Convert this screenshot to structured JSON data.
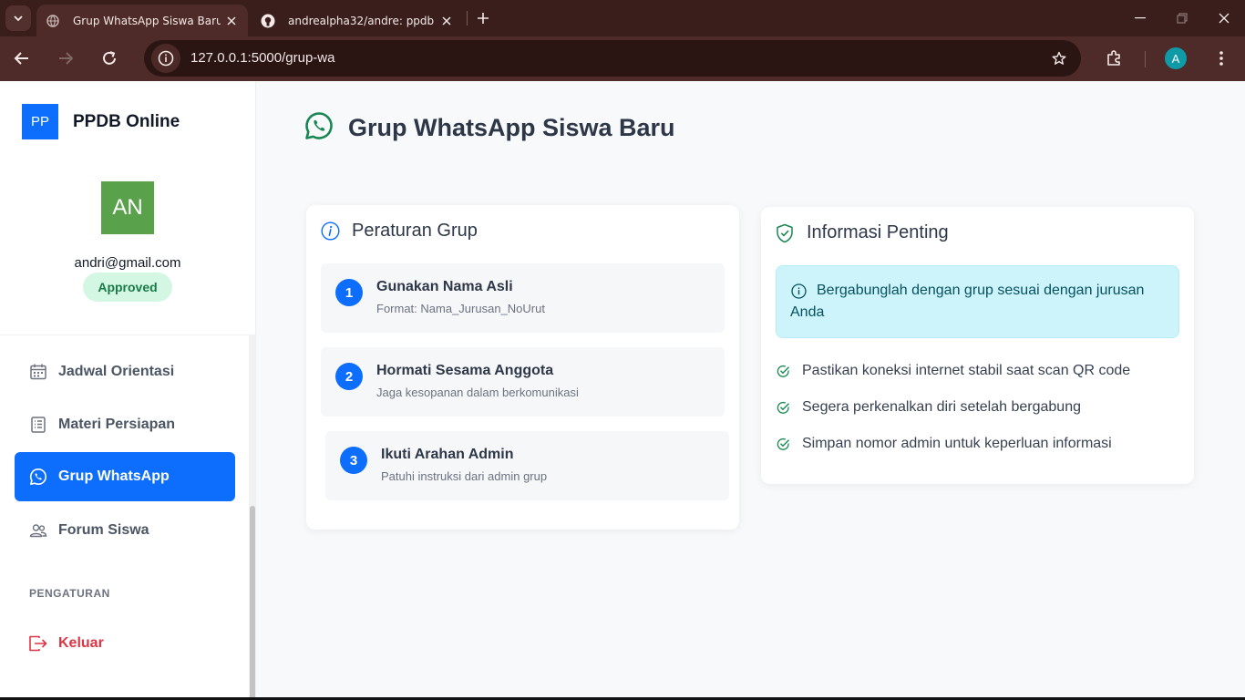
{
  "browser": {
    "tabs": [
      {
        "title": "Grup WhatsApp Siswa Baru",
        "active": true
      },
      {
        "title": "andrealpha32/andre: ppdb",
        "active": false
      }
    ],
    "url": "127.0.0.1:5000/grup-wa",
    "profile_initial": "A"
  },
  "sidebar": {
    "brand_logo": "PP",
    "brand_name": "PPDB Online",
    "avatar_initials": "AN",
    "email": "andri@gmail.com",
    "status": "Approved",
    "items": [
      {
        "label": "Jadwal Orientasi",
        "icon": "calendar-icon"
      },
      {
        "label": "Materi Persiapan",
        "icon": "document-icon"
      },
      {
        "label": "Grup WhatsApp",
        "icon": "whatsapp-icon",
        "active": true
      },
      {
        "label": "Forum Siswa",
        "icon": "people-icon"
      }
    ],
    "section_label": "PENGATURAN",
    "logout_label": "Keluar"
  },
  "main": {
    "title": "Grup WhatsApp Siswa Baru",
    "rules_card": {
      "title": "Peraturan Grup",
      "rules": [
        {
          "number": "1",
          "title": "Gunakan Nama Asli",
          "desc": "Format: Nama_Jurusan_NoUrut"
        },
        {
          "number": "2",
          "title": "Hormati Sesama Anggota",
          "desc": "Jaga kesopanan dalam berkomunikasi"
        },
        {
          "number": "3",
          "title": "Ikuti Arahan Admin",
          "desc": "Patuhi instruksi dari admin grup"
        }
      ]
    },
    "info_card": {
      "title": "Informasi Penting",
      "alert": "Bergabunglah dengan grup sesuai dengan jurusan Anda",
      "items": [
        "Pastikan koneksi internet stabil saat scan QR code",
        "Segera perkenalkan diri setelah bergabung",
        "Simpan nomor admin untuk keperluan informasi"
      ]
    }
  },
  "colors": {
    "primary": "#0d6efd",
    "whatsapp": "#198754",
    "approved_bg": "#d4f7e4",
    "logout": "#dc3545",
    "alert_bg": "#cdf4fb"
  }
}
